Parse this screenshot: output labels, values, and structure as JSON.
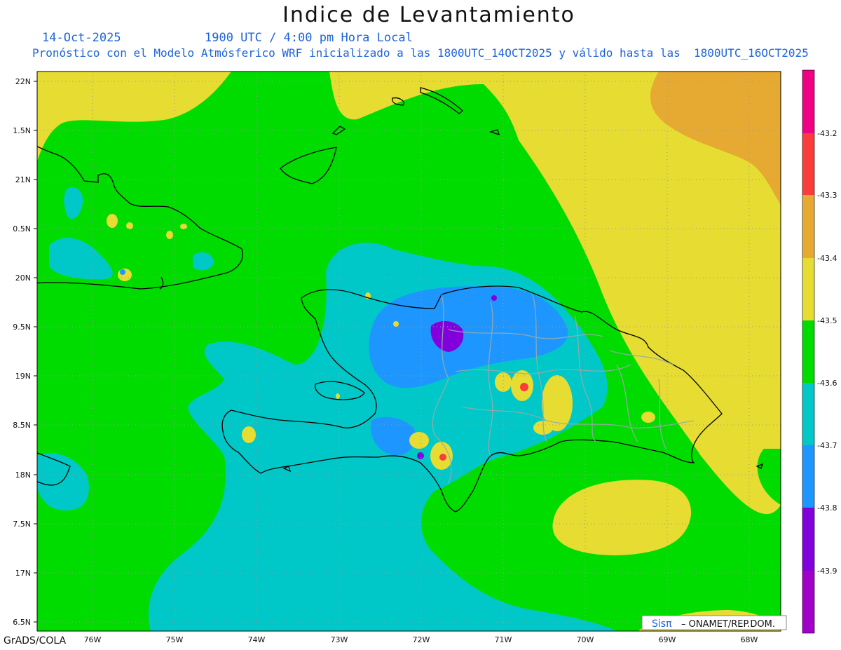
{
  "header": {
    "title": "Indice de Levantamiento",
    "date": "14-Oct-2025",
    "time": "1900 UTC / 4:00 pm Hora Local",
    "description": "Pronóstico con el Modelo Atmósferico WRF inicializado a las 1800UTC_14OCT2025 y válido hasta las  1800UTC_16OCT2025"
  },
  "axes": {
    "lat_labels": [
      "22N",
      "1.5N",
      "21N",
      "0.5N",
      "20N",
      "9.5N",
      "19N",
      "8.5N",
      "18N",
      "7.5N",
      "17N",
      "6.5N"
    ],
    "lon_labels": [
      "76W",
      "75W",
      "74W",
      "73W",
      "72W",
      "71W",
      "70W",
      "69W",
      "68W"
    ]
  },
  "colorbar": {
    "colors": [
      "#f00082",
      "#fa3c3c",
      "#e6aa32",
      "#e6dc32",
      "#00dc00",
      "#00c8c8",
      "#1e96ff",
      "#8200dc",
      "#a000c8"
    ],
    "labels": [
      "-43.2",
      "-43.3",
      "-43.4",
      "-43.5",
      "-43.6",
      "-43.7",
      "-43.8",
      "-43.9"
    ]
  },
  "palette": {
    "green": "#00dc00",
    "cyan": "#00c8c8",
    "yellow": "#e6dc32",
    "orange": "#e6aa32",
    "blue": "#1e96ff",
    "purple": "#8200dc",
    "red": "#fa3c3c"
  },
  "credit": {
    "brand": "Sisπ",
    "org": "– ONAMET/REP.DOM."
  },
  "footer": "GrADS/COLA"
}
